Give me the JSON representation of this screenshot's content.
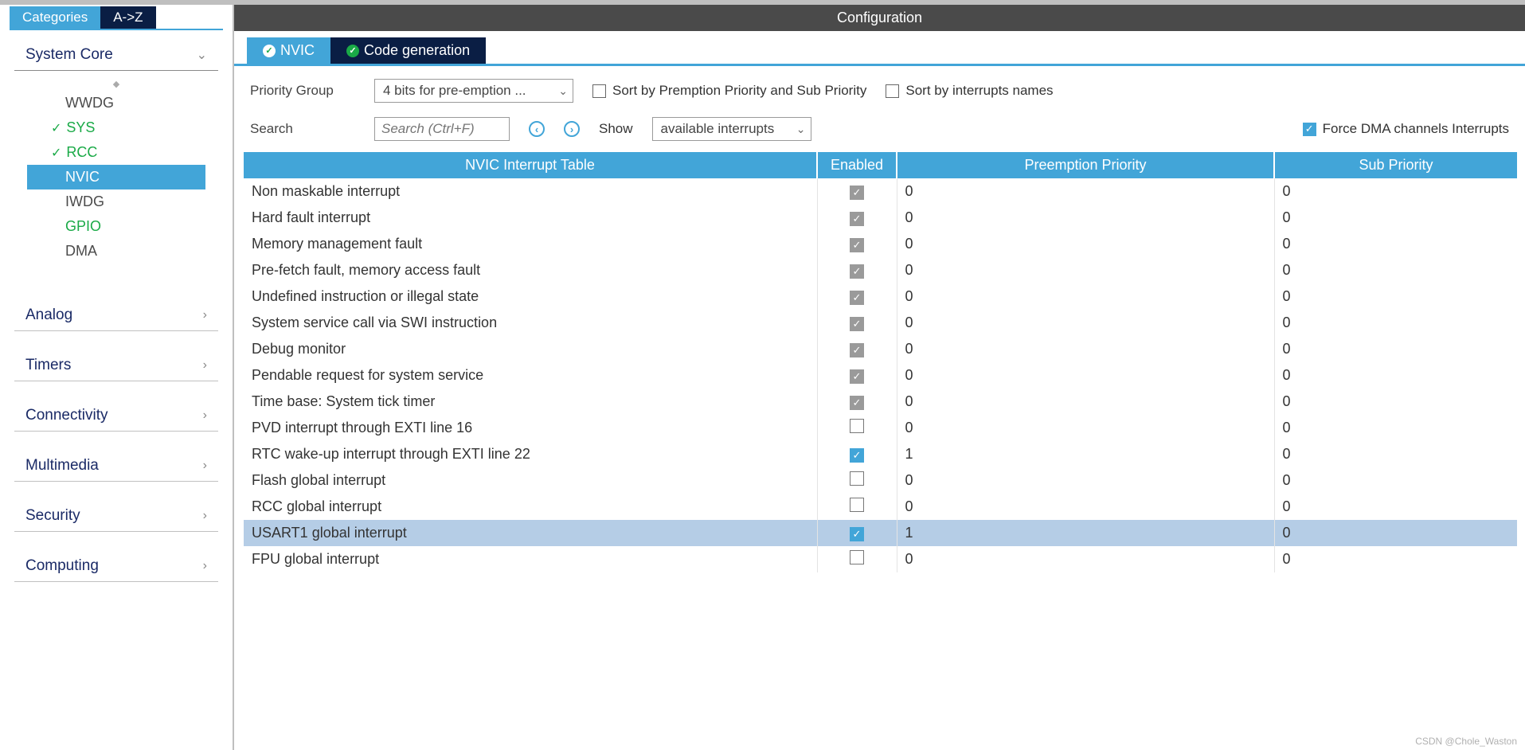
{
  "sidebar": {
    "tabs": {
      "categories": "Categories",
      "az": "A->Z"
    },
    "system_core": {
      "label": "System Core",
      "items": [
        {
          "id": "wwdg",
          "label": "WWDG",
          "configured": false,
          "selected": false
        },
        {
          "id": "sys",
          "label": "SYS",
          "configured": true,
          "selected": false
        },
        {
          "id": "rcc",
          "label": "RCC",
          "configured": true,
          "selected": false
        },
        {
          "id": "nvic",
          "label": "NVIC",
          "configured": false,
          "selected": true
        },
        {
          "id": "iwdg",
          "label": "IWDG",
          "configured": false,
          "selected": false
        },
        {
          "id": "gpio",
          "label": "GPIO",
          "configured": true,
          "selected": false,
          "no_tick": true
        },
        {
          "id": "dma",
          "label": "DMA",
          "configured": false,
          "selected": false
        }
      ]
    },
    "cats": [
      {
        "id": "analog",
        "label": "Analog"
      },
      {
        "id": "timers",
        "label": "Timers"
      },
      {
        "id": "connectivity",
        "label": "Connectivity"
      },
      {
        "id": "multimedia",
        "label": "Multimedia"
      },
      {
        "id": "security",
        "label": "Security"
      },
      {
        "id": "computing",
        "label": "Computing"
      }
    ]
  },
  "main": {
    "title": "Configuration",
    "tabs": {
      "nvic": "NVIC",
      "codegen": "Code generation"
    },
    "priority_group_label": "Priority Group",
    "priority_group_value": "4 bits for pre-emption ...",
    "sort_by_prio_label": "Sort by Premption Priority and Sub Priority",
    "sort_by_name_label": "Sort by interrupts names",
    "search_label": "Search",
    "search_placeholder": "Search (Ctrl+F)",
    "show_label": "Show",
    "show_value": "available interrupts",
    "force_dma_label": "Force DMA channels Interrupts",
    "force_dma_checked": true,
    "table": {
      "headers": {
        "name": "NVIC Interrupt Table",
        "enabled": "Enabled",
        "pre": "Preemption Priority",
        "sub": "Sub Priority"
      },
      "rows": [
        {
          "name": "Non maskable interrupt",
          "enabled": true,
          "locked": true,
          "pre": "0",
          "sub": "0"
        },
        {
          "name": "Hard fault interrupt",
          "enabled": true,
          "locked": true,
          "pre": "0",
          "sub": "0"
        },
        {
          "name": "Memory management fault",
          "enabled": true,
          "locked": true,
          "pre": "0",
          "sub": "0"
        },
        {
          "name": "Pre-fetch fault, memory access fault",
          "enabled": true,
          "locked": true,
          "pre": "0",
          "sub": "0"
        },
        {
          "name": "Undefined instruction or illegal state",
          "enabled": true,
          "locked": true,
          "pre": "0",
          "sub": "0"
        },
        {
          "name": "System service call via SWI instruction",
          "enabled": true,
          "locked": true,
          "pre": "0",
          "sub": "0"
        },
        {
          "name": "Debug monitor",
          "enabled": true,
          "locked": true,
          "pre": "0",
          "sub": "0"
        },
        {
          "name": "Pendable request for system service",
          "enabled": true,
          "locked": true,
          "pre": "0",
          "sub": "0"
        },
        {
          "name": "Time base: System tick timer",
          "enabled": true,
          "locked": true,
          "pre": "0",
          "sub": "0"
        },
        {
          "name": "PVD interrupt through EXTI line 16",
          "enabled": false,
          "locked": false,
          "pre": "0",
          "sub": "0"
        },
        {
          "name": "RTC wake-up interrupt through EXTI line 22",
          "enabled": true,
          "locked": false,
          "pre": "1",
          "sub": "0"
        },
        {
          "name": "Flash global interrupt",
          "enabled": false,
          "locked": false,
          "pre": "0",
          "sub": "0"
        },
        {
          "name": "RCC global interrupt",
          "enabled": false,
          "locked": false,
          "pre": "0",
          "sub": "0"
        },
        {
          "name": "USART1 global interrupt",
          "enabled": true,
          "locked": false,
          "pre": "1",
          "sub": "0",
          "highlight": true
        },
        {
          "name": "FPU global interrupt",
          "enabled": false,
          "locked": false,
          "pre": "0",
          "sub": "0"
        }
      ]
    },
    "watermark": "CSDN @Chole_Waston"
  }
}
